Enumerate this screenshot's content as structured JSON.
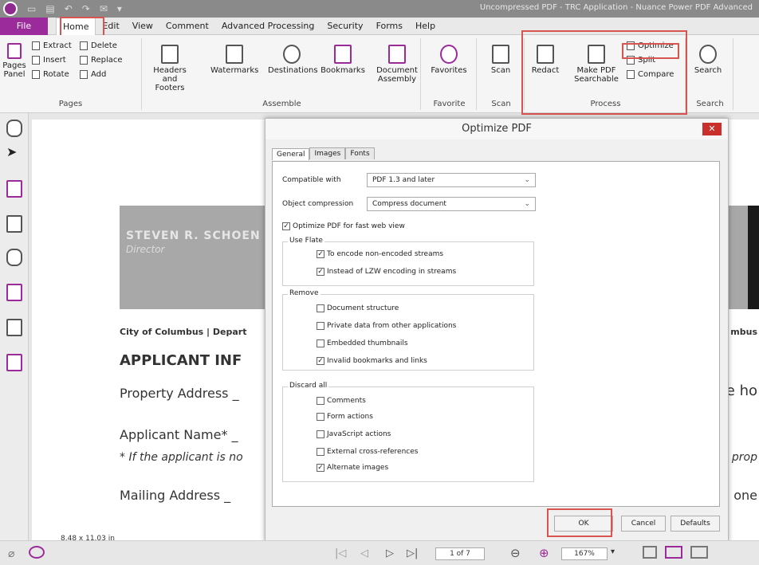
{
  "title_bar": {
    "title": "Uncompressed PDF - TRC Application - Nuance Power PDF Advanced"
  },
  "tabs": [
    "File",
    "Home",
    "Edit",
    "View",
    "Comment",
    "Advanced Processing",
    "Security",
    "Forms",
    "Help"
  ],
  "ribbon": {
    "pages_panel": "Pages Panel",
    "extract": "Extract",
    "insert": "Insert",
    "rotate": "Rotate",
    "delete": "Delete",
    "replace": "Replace",
    "add": "Add",
    "headers_footers": "Headers and Footers",
    "watermarks": "Watermarks",
    "destinations": "Destinations",
    "bookmarks": "Bookmarks",
    "document_assembly": "Document Assembly",
    "favorites": "Favorites",
    "scan": "Scan",
    "redact": "Redact",
    "make_searchable": "Make PDF Searchable",
    "optimize": "Optimize",
    "split": "Split",
    "compare": "Compare",
    "search": "Search",
    "groups": {
      "pages": "Pages",
      "assemble": "Assemble",
      "favorite": "Favorite",
      "scan": "Scan",
      "process": "Process",
      "search": "Search"
    }
  },
  "document": {
    "header_name": "STEVEN R. SCHOEN",
    "header_role": "Director",
    "line1": "City of Columbus | Depart",
    "line1_right": "mbus",
    "heading": "APPLICANT INF",
    "field1": "Property Address _",
    "field1_right": "e ho",
    "field2": "Applicant Name* _",
    "field3": "* If the applicant is no",
    "field3_right": "prop",
    "field4": "Mailing Address _",
    "field4_right": "one"
  },
  "dialog": {
    "title": "Optimize PDF",
    "tabs": [
      "General",
      "Images",
      "Fonts"
    ],
    "compatible_label": "Compatible with",
    "compatible_value": "PDF 1.3 and later",
    "compression_label": "Object compression",
    "compression_value": "Compress document",
    "fast_web": "Optimize PDF for fast web view",
    "use_flate": "Use Flate",
    "flate_options": [
      "To encode non-encoded streams",
      "Instead of LZW encoding in streams"
    ],
    "remove": "Remove",
    "remove_options": [
      "Document structure",
      "Private data from other applications",
      "Embedded thumbnails",
      "Invalid bookmarks and links"
    ],
    "discard": "Discard all",
    "discard_options": [
      "Comments",
      "Form actions",
      "JavaScript actions",
      "External cross-references",
      "Alternate images"
    ],
    "ok": "OK",
    "cancel": "Cancel",
    "defaults": "Defaults"
  },
  "status": {
    "page_size": "8.48 x 11.03 in",
    "page_counter": "1 of 7",
    "zoom": "167%"
  }
}
